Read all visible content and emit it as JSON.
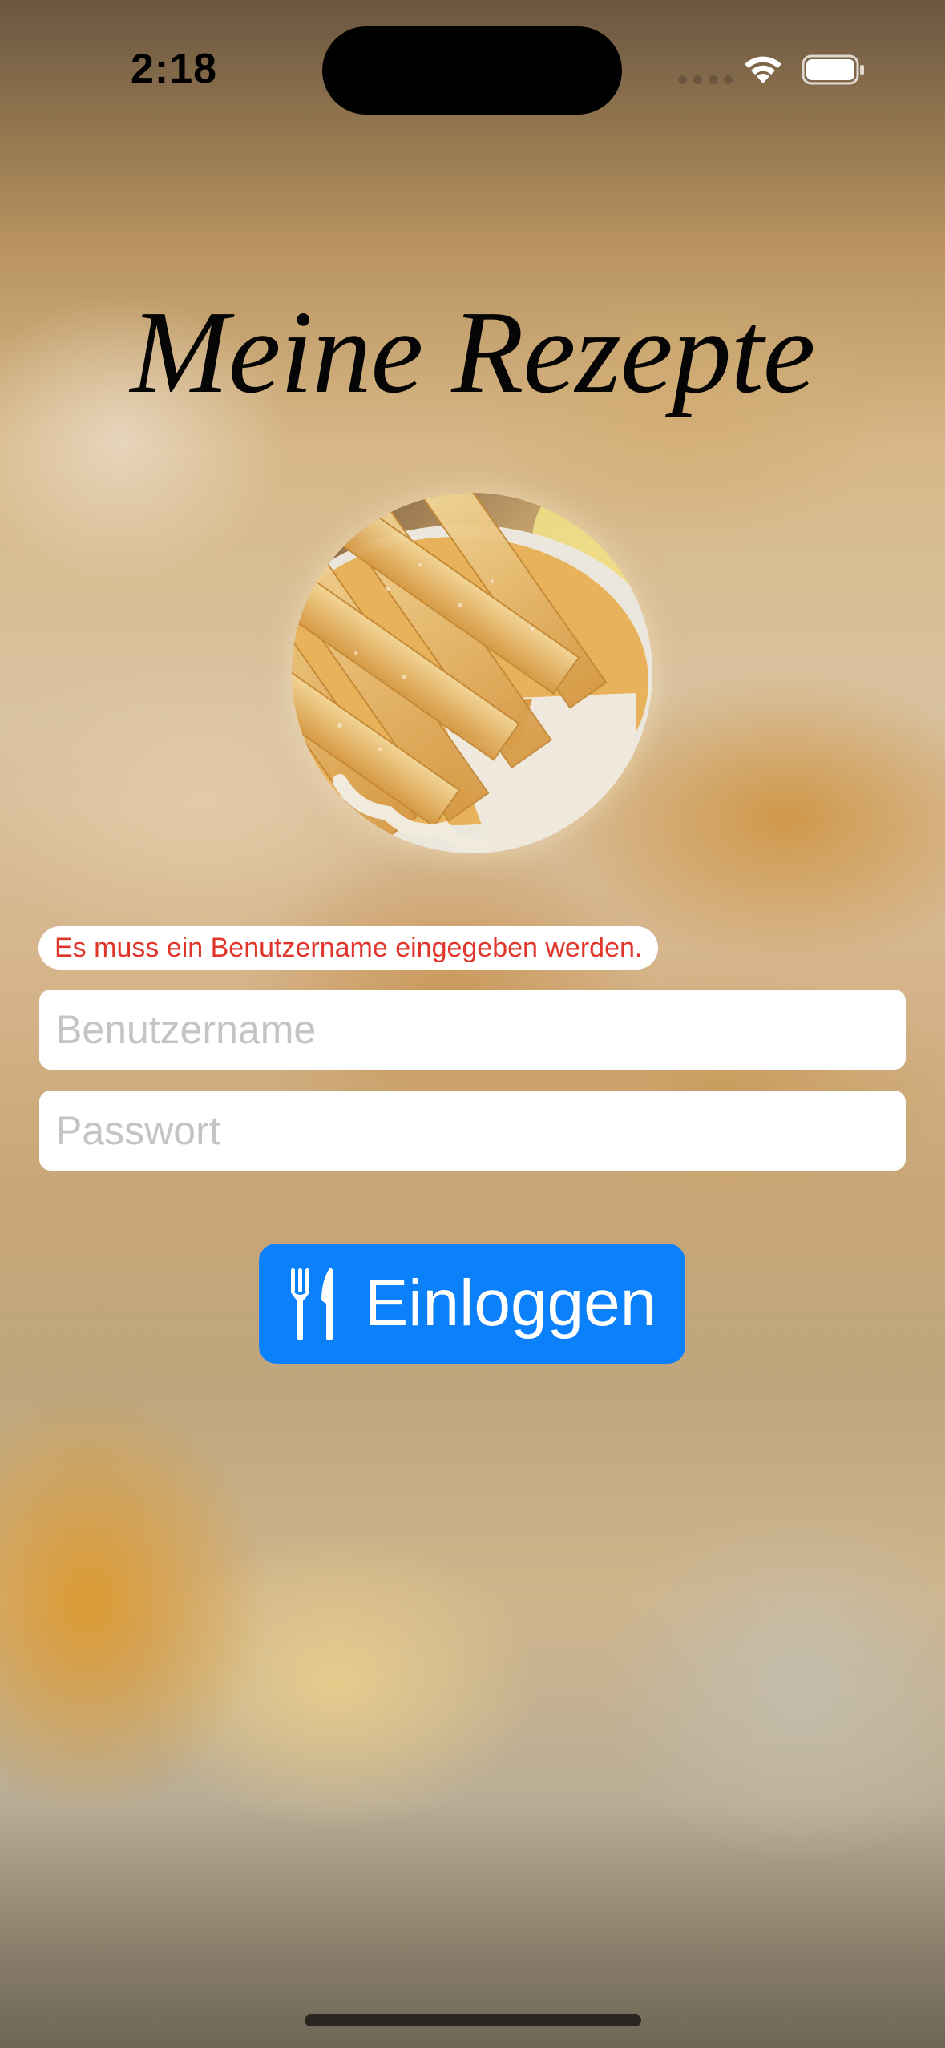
{
  "status_bar": {
    "time": "2:18",
    "icons": [
      "cellular-dots-icon",
      "wifi-icon",
      "battery-icon"
    ]
  },
  "app": {
    "title": "Meine Rezepte",
    "hero_image": "apple-pie-photo"
  },
  "login_form": {
    "error_message": "Es muss ein Benutzername eingegeben werden.",
    "username": {
      "value": "",
      "placeholder": "Benutzername"
    },
    "password": {
      "value": "",
      "placeholder": "Passwort"
    },
    "submit": {
      "label": "Einloggen",
      "icon": "fork-knife-icon"
    }
  },
  "colors": {
    "accent": "#0b80fb",
    "error": "#e0352b",
    "field_background": "#ffffff",
    "placeholder": "#c4c4c6"
  }
}
